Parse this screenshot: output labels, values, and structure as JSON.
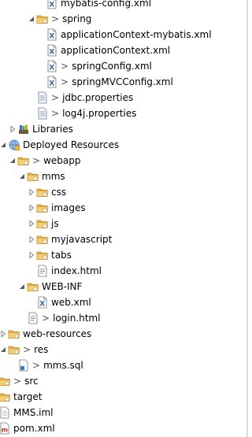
{
  "tree": {
    "rows": [
      {
        "label": "mybatis-config.xml",
        "icon": "xml-file-icon",
        "expanded": null,
        "prefix": ""
      },
      {
        "label": "spring",
        "icon": "folder-icon",
        "expanded": true,
        "prefix": ">"
      },
      {
        "label": "applicationContext-mybatis.xml",
        "icon": "xml-file-icon",
        "expanded": null,
        "prefix": ""
      },
      {
        "label": "applicationContext.xml",
        "icon": "xml-file-icon",
        "expanded": null,
        "prefix": ""
      },
      {
        "label": "springConfig.xml",
        "icon": "xml-file-icon",
        "expanded": null,
        "prefix": ">"
      },
      {
        "label": "springMVCConfig.xml",
        "icon": "xml-file-icon",
        "expanded": null,
        "prefix": ">"
      },
      {
        "label": "jdbc.properties",
        "icon": "properties-file-icon",
        "expanded": null,
        "prefix": ">"
      },
      {
        "label": "log4j.properties",
        "icon": "properties-file-icon",
        "expanded": null,
        "prefix": ">"
      },
      {
        "label": "Libraries",
        "icon": "library-icon",
        "expanded": false,
        "prefix": ""
      },
      {
        "label": "Deployed Resources",
        "icon": "web-deploy-icon",
        "expanded": true,
        "prefix": ""
      },
      {
        "label": "webapp",
        "icon": "folder-icon",
        "expanded": true,
        "prefix": ">"
      },
      {
        "label": "mms",
        "icon": "folder-icon",
        "expanded": true,
        "prefix": ""
      },
      {
        "label": "css",
        "icon": "folder-icon",
        "expanded": false,
        "prefix": ""
      },
      {
        "label": "images",
        "icon": "folder-icon",
        "expanded": false,
        "prefix": ""
      },
      {
        "label": "js",
        "icon": "folder-icon",
        "expanded": false,
        "prefix": ""
      },
      {
        "label": "myjavascript",
        "icon": "folder-icon",
        "expanded": false,
        "prefix": ""
      },
      {
        "label": "tabs",
        "icon": "folder-icon",
        "expanded": false,
        "prefix": ""
      },
      {
        "label": "index.html",
        "icon": "html-file-icon",
        "expanded": null,
        "prefix": ""
      },
      {
        "label": "WEB-INF",
        "icon": "folder-icon",
        "expanded": true,
        "prefix": ""
      },
      {
        "label": "web.xml",
        "icon": "xml-file-icon",
        "expanded": null,
        "prefix": ""
      },
      {
        "label": "login.html",
        "icon": "html-file-icon",
        "expanded": null,
        "prefix": ">"
      },
      {
        "label": "web-resources",
        "icon": "folder-icon",
        "expanded": false,
        "prefix": ""
      },
      {
        "label": "res",
        "icon": "folder-icon",
        "expanded": true,
        "prefix": ">"
      },
      {
        "label": "mms.sql",
        "icon": "sql-file-icon",
        "expanded": null,
        "prefix": ">"
      },
      {
        "label": "src",
        "icon": "folder-icon",
        "expanded": false,
        "prefix": ">"
      },
      {
        "label": "target",
        "icon": "folder-icon",
        "expanded": false,
        "prefix": ""
      },
      {
        "label": "MMS.iml",
        "icon": "iml-file-icon",
        "expanded": null,
        "prefix": ""
      },
      {
        "label": "pom.xml",
        "icon": "pom-file-icon",
        "expanded": null,
        "prefix": ""
      }
    ]
  },
  "colors": {
    "folder": "#e8b04a",
    "folder_dark": "#c58a24",
    "xml_page": "#ffffff",
    "xml_mark": "#d9a21b",
    "text": "#000000",
    "twisty": "#7a7a7a"
  }
}
